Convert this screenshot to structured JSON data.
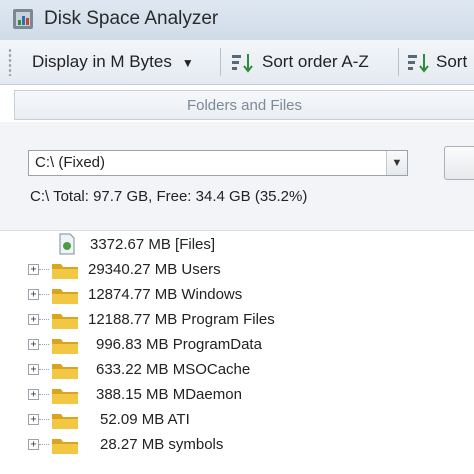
{
  "window": {
    "title": "Disk Space Analyzer"
  },
  "toolbar": {
    "display_label": "Display in M Bytes",
    "sort_label": "Sort order A-Z",
    "sort_label_clipped": "Sort"
  },
  "section": {
    "header": "Folders and Files"
  },
  "drive": {
    "selected": "C:\\ (Fixed)",
    "info": "C:\\ Total: 97.7 GB, Free: 34.4 GB (35.2%)"
  },
  "tree": {
    "items": [
      {
        "text": "3372.67 MB [Files]",
        "icon": "files-icon",
        "expandable": false
      },
      {
        "text": "29340.27 MB Users",
        "icon": "folder-icon",
        "expandable": true
      },
      {
        "text": "12874.77 MB Windows",
        "icon": "folder-icon",
        "expandable": true
      },
      {
        "text": "12188.77 MB Program Files",
        "icon": "folder-icon",
        "expandable": true
      },
      {
        "text": "996.83 MB ProgramData",
        "icon": "folder-icon",
        "expandable": true
      },
      {
        "text": "633.22 MB MSOCache",
        "icon": "folder-icon",
        "expandable": true
      },
      {
        "text": "388.15 MB MDaemon",
        "icon": "folder-icon",
        "expandable": true
      },
      {
        "text": "52.09 MB ATI",
        "icon": "folder-icon",
        "expandable": true
      },
      {
        "text": "28.27 MB symbols",
        "icon": "folder-icon",
        "expandable": true
      }
    ]
  },
  "colors": {
    "folder": "#f2c744",
    "folder_dark": "#d9a520",
    "titlebar": "#d6e1ec"
  }
}
